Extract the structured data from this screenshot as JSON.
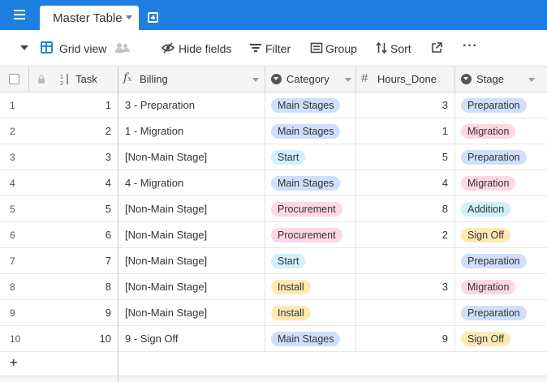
{
  "tab": {
    "label": "Master Table"
  },
  "toolbar": {
    "view_label": "Grid view",
    "hide_fields": "Hide fields",
    "filter": "Filter",
    "group": "Group",
    "sort": "Sort",
    "more": "···"
  },
  "columns": {
    "task": "Task",
    "billing": "Billing",
    "category": "Category",
    "hours": "Hours_Done",
    "stage": "Stage"
  },
  "add_row_label": "+",
  "colors": {
    "topbar": "#1f7fe0",
    "Main Stages": "#cfdffb",
    "Start": "#d0f0fb",
    "Procurement": "#fdd7e4",
    "Install": "#ffe9b3",
    "Preparation": "#cfdffb",
    "Migration": "#fdd7e4",
    "Addition": "#d0f0fb",
    "Sign Off": "#ffe9b3"
  },
  "rows": [
    {
      "num": "1",
      "task": "1",
      "billing": "3 - Preparation",
      "category": "Main Stages",
      "hours": "3",
      "stage": "Preparation"
    },
    {
      "num": "2",
      "task": "2",
      "billing": "1 - Migration",
      "category": "Main Stages",
      "hours": "1",
      "stage": "Migration"
    },
    {
      "num": "3",
      "task": "3",
      "billing": "[Non-Main Stage]",
      "category": "Start",
      "hours": "5",
      "stage": "Preparation"
    },
    {
      "num": "4",
      "task": "4",
      "billing": "4 - Migration",
      "category": "Main Stages",
      "hours": "4",
      "stage": "Migration"
    },
    {
      "num": "5",
      "task": "5",
      "billing": "[Non-Main Stage]",
      "category": "Procurement",
      "hours": "8",
      "stage": "Addition"
    },
    {
      "num": "6",
      "task": "6",
      "billing": "[Non-Main Stage]",
      "category": "Procurement",
      "hours": "2",
      "stage": "Sign Off"
    },
    {
      "num": "7",
      "task": "7",
      "billing": "[Non-Main Stage]",
      "category": "Start",
      "hours": "",
      "stage": "Preparation"
    },
    {
      "num": "8",
      "task": "8",
      "billing": "[Non-Main Stage]",
      "category": "Install",
      "hours": "3",
      "stage": "Migration"
    },
    {
      "num": "9",
      "task": "9",
      "billing": "[Non-Main Stage]",
      "category": "Install",
      "hours": "",
      "stage": "Preparation"
    },
    {
      "num": "10",
      "task": "10",
      "billing": "9 - Sign Off",
      "category": "Main Stages",
      "hours": "9",
      "stage": "Sign Off"
    }
  ]
}
